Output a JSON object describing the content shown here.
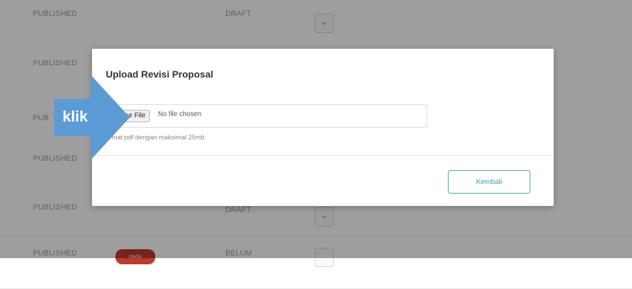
{
  "background_rows": [
    {
      "status": "PUBLISHED",
      "state": "DRAFT",
      "has_toggle": true,
      "badge": ""
    },
    {
      "status": "PUBLISHED",
      "state": "",
      "has_toggle": false,
      "badge": ""
    },
    {
      "status": "PUB",
      "state": "",
      "has_toggle": false,
      "badge": ""
    },
    {
      "status": "PUBLISHED",
      "state": "",
      "has_toggle": false,
      "badge": ""
    },
    {
      "status": "PUBLISHED",
      "state": "DRAFT",
      "has_toggle": true,
      "badge": ""
    },
    {
      "status": "PUBLISHED",
      "state": "BELUM",
      "has_toggle": true,
      "badge": "revisi"
    }
  ],
  "modal": {
    "title": "Upload Revisi Proposal",
    "file_button_label": "oose File",
    "file_status": "No file chosen",
    "help_text": "ormat pdf dengan maksimal 25mb",
    "back_button_label": "Kembali"
  },
  "annotation": {
    "label": "klik",
    "color": "#5b9bd5"
  },
  "colors": {
    "accent": "#3a9bb0",
    "overlay": "rgba(0,0,0,0.38)"
  }
}
